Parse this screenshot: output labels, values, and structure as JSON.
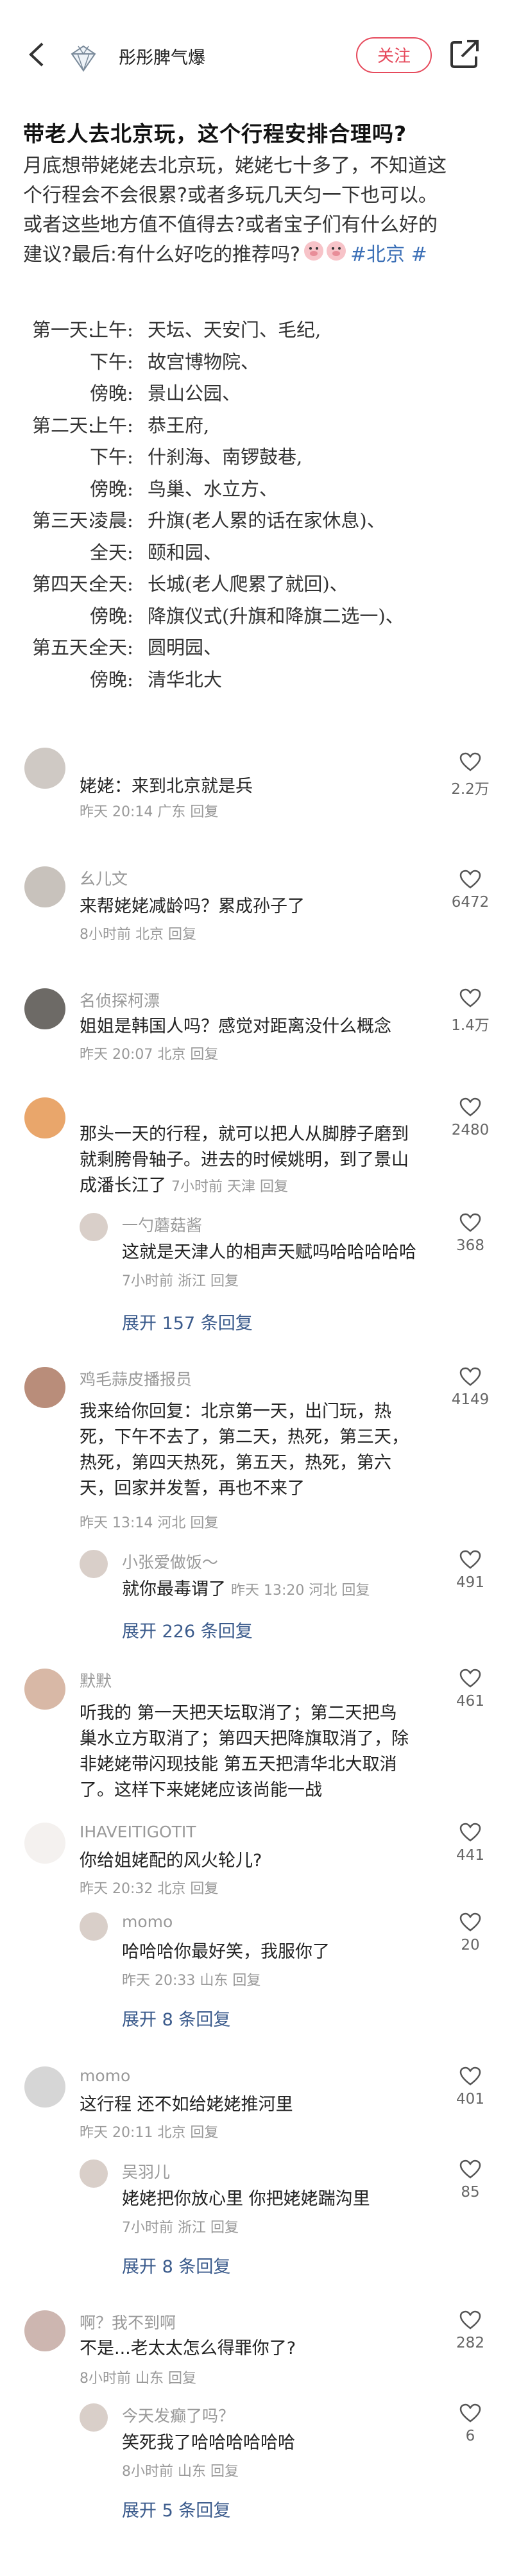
{
  "header": {
    "username": "彤彤脾气爆",
    "follow_label": "关注"
  },
  "post": {
    "title": "带老人去北京玩，这个行程安排合理吗?",
    "body_lines": [
      "月底想带姥姥去北京玩，姥姥七十多了，不知道这",
      "个行程会不会很累?或者多玩几天匀一下也可以。",
      "或者这些地方值不值得去?或者宝子们有什么好的",
      "建议?最后:有什么好吃的推荐吗?"
    ],
    "hashtag": "#北京",
    "hashtag_tail": "#",
    "itinerary": [
      {
        "day": "第一天:",
        "time": "上午:",
        "act": "天坛、天安门、毛纪,"
      },
      {
        "day": "",
        "time": "下午:",
        "act": "故宫博物院、"
      },
      {
        "day": "",
        "time": "傍晚:",
        "act": "景山公园、"
      },
      {
        "day": "第二天:",
        "time": "上午:",
        "act": "恭王府,"
      },
      {
        "day": "",
        "time": "下午:",
        "act": "什刹海、南锣鼓巷,"
      },
      {
        "day": "",
        "time": "傍晚:",
        "act": "鸟巢、水立方、"
      },
      {
        "day": "第三天:",
        "time": "凌晨:",
        "act": "升旗(老人累的话在家休息)、"
      },
      {
        "day": "",
        "time": "全天:",
        "act": "颐和园、"
      },
      {
        "day": "第四天:",
        "time": "全天:",
        "act": "长城(老人爬累了就回)、"
      },
      {
        "day": "",
        "time": "傍晚:",
        "act": "降旗仪式(升旗和降旗二选一)、"
      },
      {
        "day": "第五天:",
        "time": "全天:",
        "act": "圆明园、"
      },
      {
        "day": "",
        "time": "傍晚:",
        "act": "清华北大"
      }
    ]
  },
  "comments": [
    {
      "name": "",
      "text": "姥姥：来到北京就是兵",
      "meta": "昨天 20:14 广东  回复",
      "likes": "2.2万"
    },
    {
      "name": "幺儿文",
      "text": "来帮姥姥减龄吗？累成孙子了",
      "meta": "8小时前 北京  回复",
      "likes": "6472"
    },
    {
      "name": "名侦探柯漂",
      "text": "姐姐是韩国人吗？感觉对距离没什么概念",
      "meta": "昨天 20:07 北京  回复",
      "likes": "1.4万"
    },
    {
      "name": "",
      "text_lines": [
        "那头一天的行程，就可以把人从脚脖子磨到",
        "就剩胯骨轴子。进去的时候姚明，到了景山",
        "成潘长江了"
      ],
      "meta_inline": "7小时前 天津  回复",
      "likes": "2480",
      "reply": {
        "name": "一勺蘑菇酱",
        "text": "这就是天津人的相声天赋吗哈哈哈哈哈",
        "meta": "7小时前 浙江  回复",
        "likes": "368"
      },
      "expand": "展开 157 条回复"
    },
    {
      "name": "鸡毛蒜皮播报员",
      "text_lines": [
        "我来给你回复：北京第一天，出门玩，热",
        "死，下午不去了，第二天，热死，第三天，",
        "热死，第四天热死，第五天，热死，第六",
        "天，回家并发誓，再也不来了"
      ],
      "meta": "昨天 13:14 河北  回复",
      "likes": "4149",
      "reply": {
        "name": "小张爱做饭～",
        "text": "就你最毒谓了",
        "meta_inline": "昨天 13:20 河北  回复",
        "likes": "491"
      },
      "expand": "展开 226 条回复"
    },
    {
      "name": "默默",
      "text_lines": [
        "听我的 第一天把天坛取消了；第二天把鸟",
        "巢水立方取消了；第四天把降旗取消了，除",
        "非姥姥带闪现技能 第五天把清华北大取消",
        "了。这样下来姥姥应该尚能一战"
      ],
      "meta": "",
      "likes": "461"
    },
    {
      "name": "IHAVEITIGOTIT",
      "text": "你给姐姥配的风火轮儿?",
      "meta": "昨天 20:32 北京  回复",
      "likes": "441",
      "reply": {
        "name": "momo",
        "text": "哈哈哈你最好笑，我服你了",
        "meta": "昨天 20:33 山东  回复",
        "likes": "20"
      },
      "expand": "展开 8 条回复"
    },
    {
      "name": "momo",
      "text": "这行程 还不如给姥姥推河里",
      "meta": "昨天 20:11 北京  回复",
      "likes": "401",
      "reply": {
        "name": "吴羽儿",
        "text": "姥姥把你放心里 你把姥姥踹沟里",
        "meta": "7小时前 浙江  回复",
        "likes": "85"
      },
      "expand": "展开 8 条回复"
    },
    {
      "name": "啊？我不到啊",
      "text": "不是...老太太怎么得罪你了?",
      "meta": "8小时前 山东  回复",
      "likes": "282",
      "reply": {
        "name": "今天发癫了吗？",
        "text": "笑死我了哈哈哈哈哈哈",
        "meta": "8小时前 山东  回复",
        "likes": "6"
      },
      "expand": "展开 5 条回复"
    }
  ],
  "colors": {
    "accent": "#e64a5c",
    "link": "#3b5b8c",
    "hashtag": "#3b6fb6"
  }
}
